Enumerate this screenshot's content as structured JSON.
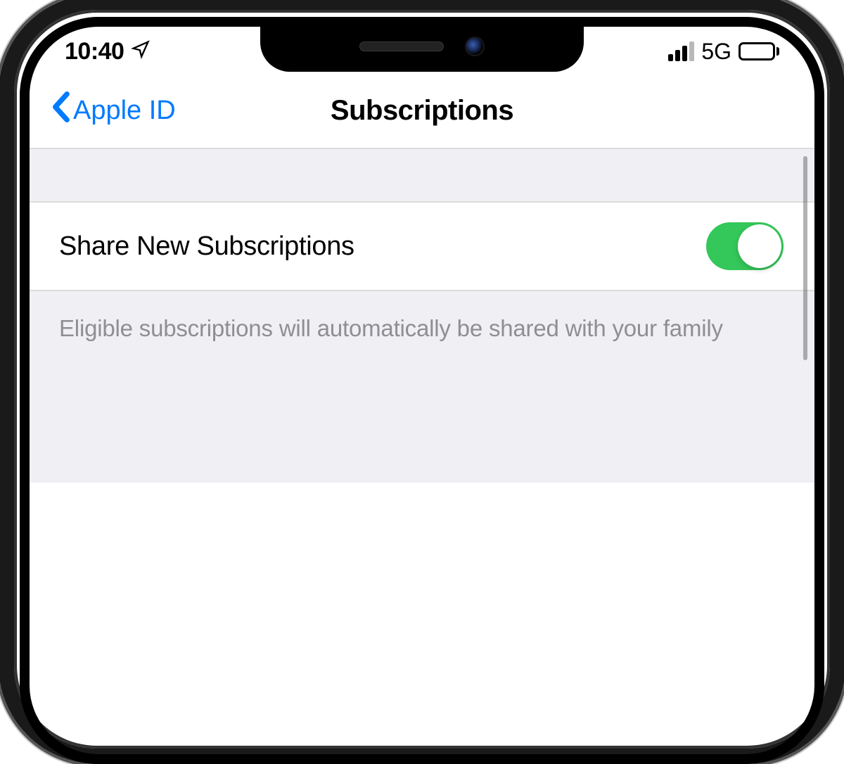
{
  "statusBar": {
    "time": "10:40",
    "network": "5G"
  },
  "navBar": {
    "backLabel": "Apple ID",
    "title": "Subscriptions"
  },
  "settings": {
    "shareNew": {
      "label": "Share New Subscriptions",
      "enabled": true
    },
    "footerText": "Eligible subscriptions will automatically be shared with your family"
  }
}
